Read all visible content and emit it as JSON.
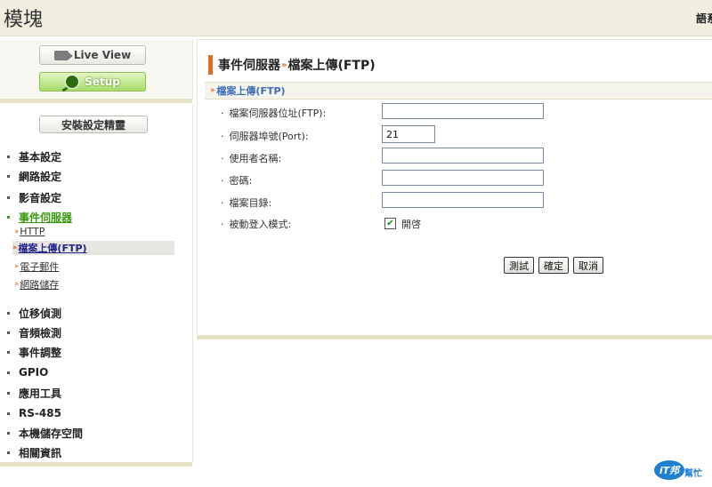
{
  "header": {
    "app_title": "模塊",
    "lang_label": "語系"
  },
  "nav": {
    "live_view": "Live View",
    "setup": "Setup"
  },
  "sidebar": {
    "wizard": "安裝設定精靈",
    "items": [
      {
        "label": "基本設定"
      },
      {
        "label": "網路設定"
      },
      {
        "label": "影音設定"
      },
      {
        "label": "事件伺服器"
      },
      {
        "label": "位移偵測"
      },
      {
        "label": "音頻檢測"
      },
      {
        "label": "事件調整"
      },
      {
        "label": "GPIO"
      },
      {
        "label": "應用工具"
      },
      {
        "label": "RS-485"
      },
      {
        "label": "本機儲存空間"
      },
      {
        "label": "相關資訊"
      }
    ],
    "sub_items": [
      {
        "label": "HTTP"
      },
      {
        "label": "檔案上傳(FTP)"
      },
      {
        "label": "電子郵件"
      },
      {
        "label": "網路儲存"
      }
    ]
  },
  "main": {
    "heading_part1": "事件伺服器",
    "heading_sep": "»",
    "heading_part2": "檔案上傳(FTP)",
    "section_title": "檔案上傳(FTP)",
    "fields": {
      "server_label": "檔案伺服器位址(FTP):",
      "server_value": "",
      "port_label": "伺服器埠號(Port):",
      "port_value": "21",
      "username_label": "使用者名稱:",
      "username_value": "",
      "password_label": "密碼:",
      "password_value": "",
      "directory_label": "檔案目錄:",
      "directory_value": "",
      "passive_label": "被動登入模式:",
      "passive_option": "開啓",
      "passive_checked": true
    },
    "buttons": {
      "test": "測試",
      "ok": "確定",
      "cancel": "取消"
    }
  },
  "watermark": {
    "logo_text": "iT邦",
    "tagline": "幫忙"
  }
}
